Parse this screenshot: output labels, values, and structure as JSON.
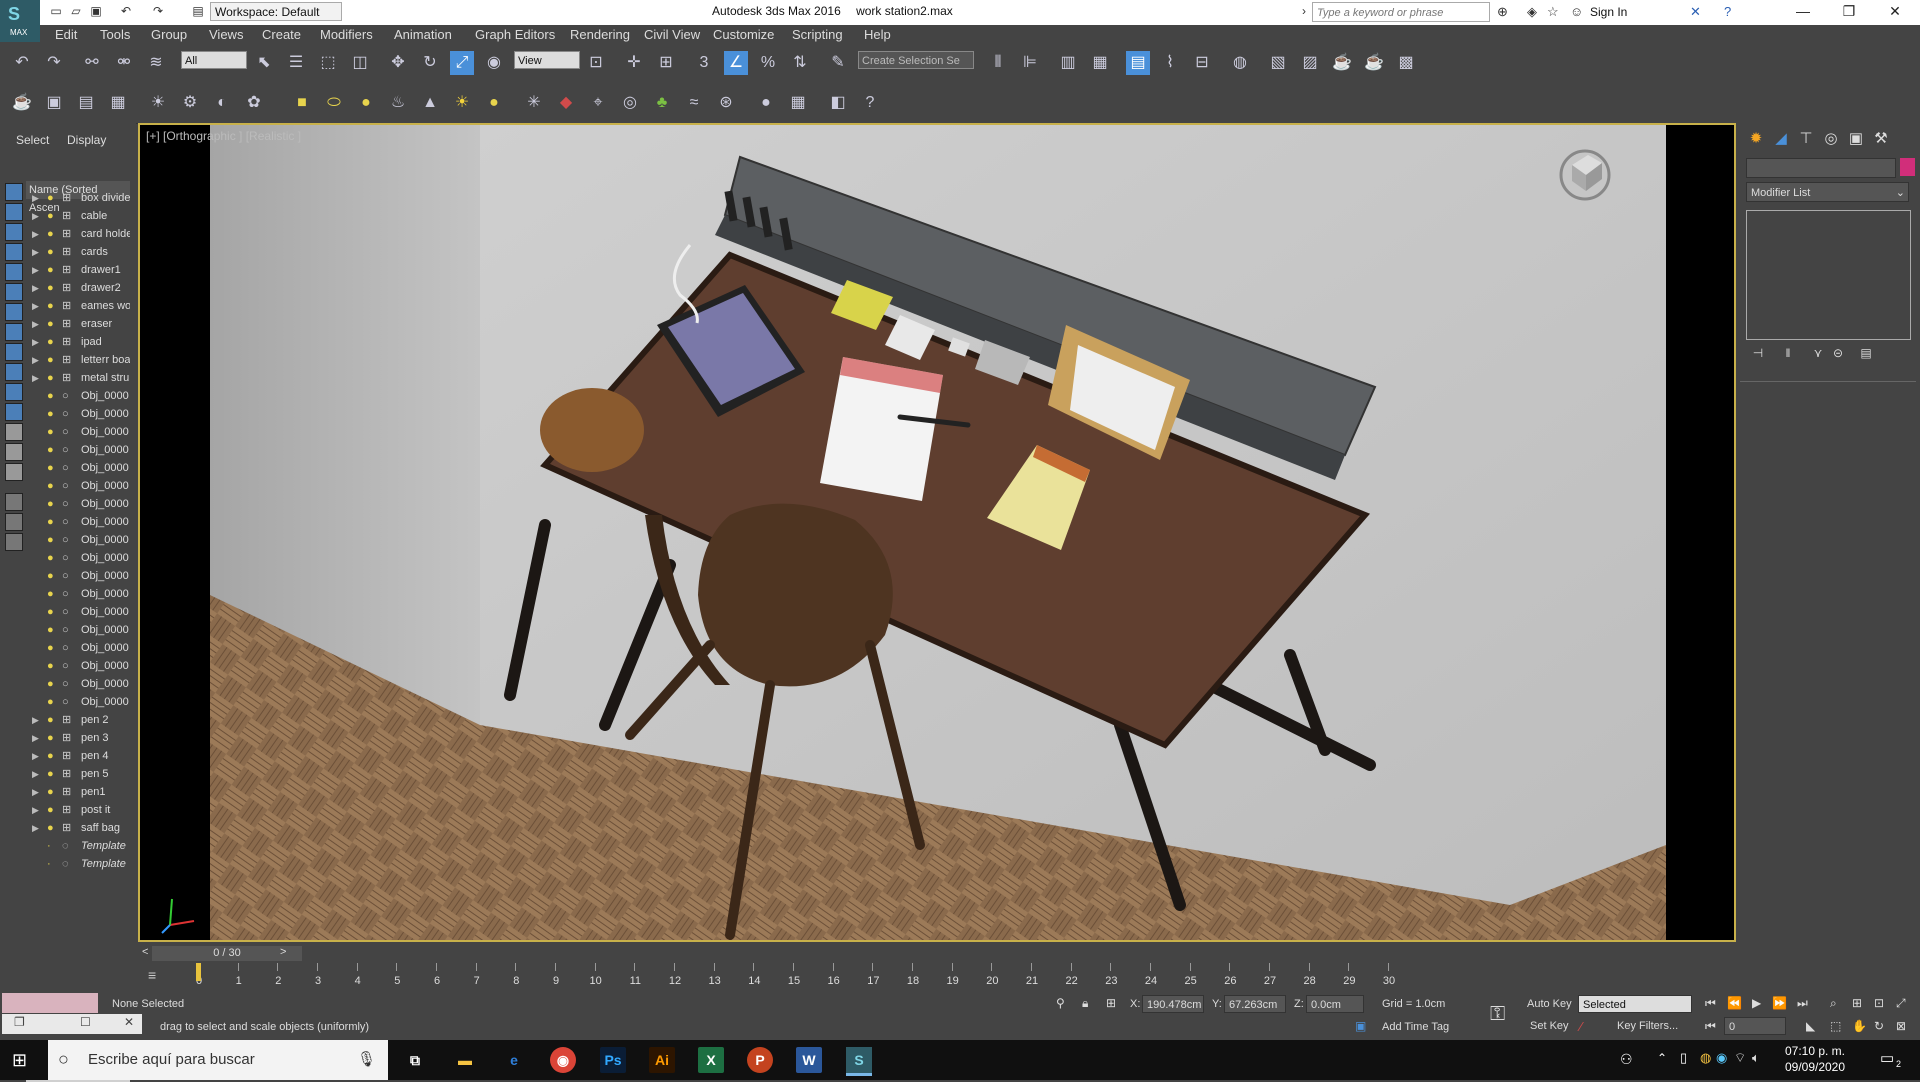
{
  "titlebar": {
    "logo_text": "MAX",
    "workspace": "Workspace: Default",
    "app_name": "Autodesk 3ds Max 2016",
    "file_name": "work station2.max",
    "search_placeholder": "Type a keyword or phrase",
    "sign_in": "Sign In"
  },
  "menu": [
    "Edit",
    "Tools",
    "Group",
    "Views",
    "Create",
    "Modifiers",
    "Animation",
    "Graph Editors",
    "Rendering",
    "Civil View",
    "Customize",
    "Scripting",
    "Help"
  ],
  "toolbar": {
    "selection_filter": "All",
    "reference_coord": "View",
    "snap_label": "3",
    "named_selection_placeholder": "Create Selection Se"
  },
  "scene_explorer": {
    "tab_select": "Select",
    "tab_display": "Display",
    "column_header": "Name (Sorted Ascen",
    "items": [
      {
        "name": "box divide",
        "type": "group"
      },
      {
        "name": "cable",
        "type": "group"
      },
      {
        "name": "card holde",
        "type": "group"
      },
      {
        "name": "cards",
        "type": "group"
      },
      {
        "name": "drawer1",
        "type": "group"
      },
      {
        "name": "drawer2",
        "type": "group"
      },
      {
        "name": "eames wo",
        "type": "group"
      },
      {
        "name": "eraser",
        "type": "group"
      },
      {
        "name": "ipad",
        "type": "group"
      },
      {
        "name": "letterr boa",
        "type": "group"
      },
      {
        "name": "metal stru",
        "type": "group"
      },
      {
        "name": "Obj_0000",
        "type": "object"
      },
      {
        "name": "Obj_0000",
        "type": "object"
      },
      {
        "name": "Obj_0000",
        "type": "object"
      },
      {
        "name": "Obj_0000",
        "type": "object"
      },
      {
        "name": "Obj_0000",
        "type": "object"
      },
      {
        "name": "Obj_0000",
        "type": "object"
      },
      {
        "name": "Obj_0000",
        "type": "object"
      },
      {
        "name": "Obj_0000",
        "type": "object"
      },
      {
        "name": "Obj_0000",
        "type": "object"
      },
      {
        "name": "Obj_0000",
        "type": "object"
      },
      {
        "name": "Obj_0000",
        "type": "object"
      },
      {
        "name": "Obj_0000",
        "type": "object"
      },
      {
        "name": "Obj_0000",
        "type": "object"
      },
      {
        "name": "Obj_0000",
        "type": "object"
      },
      {
        "name": "Obj_0000",
        "type": "object"
      },
      {
        "name": "Obj_0000",
        "type": "object"
      },
      {
        "name": "Obj_0000",
        "type": "object"
      },
      {
        "name": "Obj_0000",
        "type": "object"
      },
      {
        "name": "pen 2",
        "type": "group"
      },
      {
        "name": "pen 3",
        "type": "group"
      },
      {
        "name": "pen 4",
        "type": "group"
      },
      {
        "name": "pen 5",
        "type": "group"
      },
      {
        "name": "pen1",
        "type": "group"
      },
      {
        "name": "post it",
        "type": "group"
      },
      {
        "name": "saff bag",
        "type": "group"
      },
      {
        "name": "Template",
        "type": "template"
      },
      {
        "name": "Template",
        "type": "template"
      }
    ]
  },
  "viewport": {
    "label": "[+] [Orthographic ] [Realistic ]"
  },
  "command_panel": {
    "modifier_list": "Modifier List"
  },
  "timeline": {
    "position": "0 / 30",
    "ticks": [
      "0",
      "1",
      "2",
      "3",
      "4",
      "5",
      "6",
      "7",
      "8",
      "9",
      "10",
      "11",
      "12",
      "13",
      "14",
      "15",
      "16",
      "17",
      "18",
      "19",
      "20",
      "21",
      "22",
      "23",
      "24",
      "25",
      "26",
      "27",
      "28",
      "29",
      "30"
    ]
  },
  "status": {
    "selection_status": "None Selected",
    "prompt": "drag to select and scale objects (uniformly)",
    "x_label": "X:",
    "x_value": "190.478cm",
    "y_label": "Y:",
    "y_value": "67.263cm",
    "z_label": "Z:",
    "z_value": "0.0cm",
    "grid": "Grid = 1.0cm",
    "add_time_tag": "Add Time Tag",
    "auto_key": "Auto Key",
    "set_key": "Set Key",
    "key_mode": "Selected",
    "key_filters": "Key Filters...",
    "frame": "0"
  },
  "taskbar": {
    "search_placeholder": "Escribe aquí para buscar",
    "time": "07:10 p. m.",
    "date": "09/09/2020",
    "notifications": "2"
  }
}
